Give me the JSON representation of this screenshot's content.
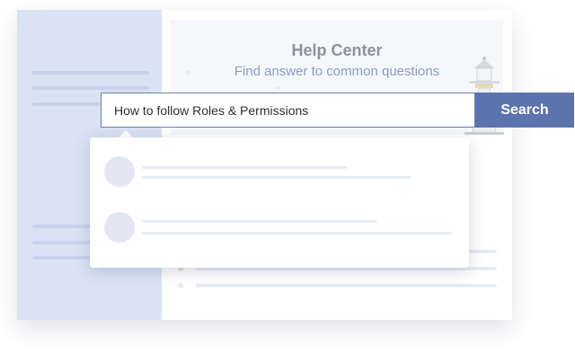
{
  "help_center": {
    "title": "Help Center",
    "subtitle": "Find answer to common questions"
  },
  "search": {
    "value": "How to follow Roles & Permissions",
    "button_label": "Search"
  },
  "suggestions": {
    "count": 2
  },
  "colors": {
    "sidebar": "#d9e3f4",
    "accent": "#5b74ad",
    "title": "#8d929b",
    "subtitle": "#8a9cc9"
  },
  "icons": {
    "illustration": "lighthouse-icon"
  }
}
